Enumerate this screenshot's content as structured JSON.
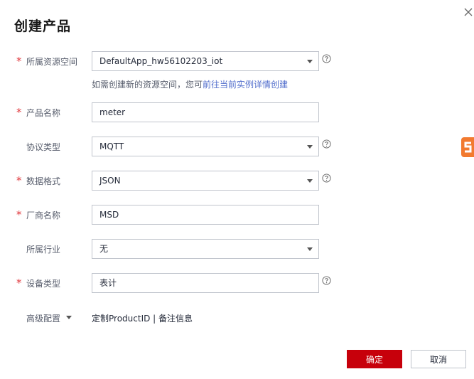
{
  "dialog": {
    "title": "创建产品"
  },
  "form": {
    "resource_space": {
      "label": "所属资源空间",
      "required": true,
      "value": "DefaultApp_hw56102203_iot"
    },
    "hint": {
      "text": "如需创建新的资源空间，您可",
      "link": "前往当前实例详情创建"
    },
    "product_name": {
      "label": "产品名称",
      "required": true,
      "value": "meter"
    },
    "protocol": {
      "label": "协议类型",
      "required": false,
      "value": "MQTT"
    },
    "data_format": {
      "label": "数据格式",
      "required": true,
      "value": "JSON"
    },
    "manufacturer": {
      "label": "厂商名称",
      "required": true,
      "value": "MSD"
    },
    "industry": {
      "label": "所属行业",
      "required": false,
      "value": "无"
    },
    "device_type": {
      "label": "设备类型",
      "required": true,
      "value": "表计"
    },
    "advanced": {
      "label": "高级配置",
      "links": "定制ProductID | 备注信息"
    },
    "required_mark": "*"
  },
  "buttons": {
    "ok": "确定",
    "cancel": "取消"
  },
  "colors": {
    "primary": "#c7000b",
    "link": "#526ecc",
    "required": "#e0393e",
    "badge": "#f27a2f"
  }
}
